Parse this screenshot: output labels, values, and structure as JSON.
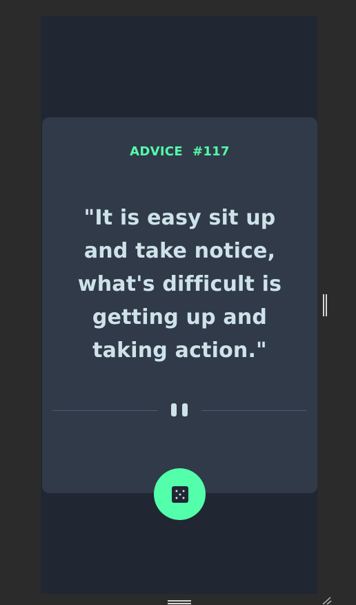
{
  "advice": {
    "label": "ADVICE",
    "number": "#117",
    "quote": "\"It is easy sit up and take notice, what's difficult is getting up and taking action.\""
  },
  "icons": {
    "divider": "pause-icon",
    "button": "dice-icon"
  },
  "colors": {
    "page_background": "#202632",
    "card_background": "#313a48",
    "accent": "#53ffaa",
    "text": "#cee3e9"
  }
}
